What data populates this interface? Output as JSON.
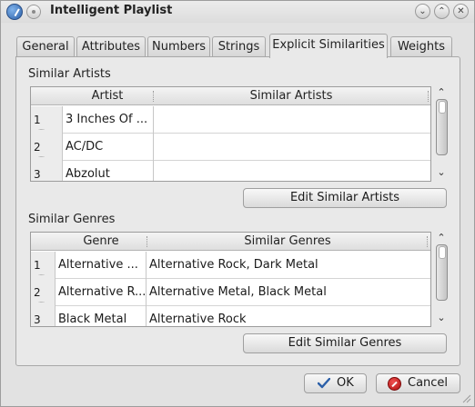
{
  "window": {
    "title": "Intelligent Playlist"
  },
  "tabs": [
    {
      "label": "General"
    },
    {
      "label": "Attributes"
    },
    {
      "label": "Numbers"
    },
    {
      "label": "Strings"
    },
    {
      "label": "Explicit Similarities",
      "active": true
    },
    {
      "label": "Weights"
    }
  ],
  "artists": {
    "group_label": "Similar Artists",
    "columns": [
      "Artist",
      "Similar Artists"
    ],
    "rows": [
      {
        "num": "1",
        "artist": "3 Inches Of ...",
        "similar": ""
      },
      {
        "num": "2",
        "artist": "AC/DC",
        "similar": ""
      },
      {
        "num": "3",
        "artist": "Abzolut",
        "similar": ""
      }
    ],
    "edit_button": "Edit Similar Artists"
  },
  "genres": {
    "group_label": "Similar Genres",
    "columns": [
      "Genre",
      "Similar Genres"
    ],
    "rows": [
      {
        "num": "1",
        "genre": "Alternative ...",
        "similar": "Alternative Rock, Dark Metal"
      },
      {
        "num": "2",
        "genre": "Alternative R...",
        "similar": "Alternative Metal, Black Metal"
      },
      {
        "num": "3",
        "genre": "Black Metal",
        "similar": "Alternative Rock"
      }
    ],
    "edit_button": "Edit Similar Genres"
  },
  "footer": {
    "ok_label": "OK",
    "cancel_label": "Cancel"
  },
  "colors": {
    "ok_check": "#2b5fa8",
    "cancel_red": "#c41a1a"
  },
  "icons": [
    "app-icon",
    "menu-icon",
    "minimize-icon",
    "maximize-icon",
    "close-icon",
    "scroll-up-icon",
    "scroll-down-icon",
    "ok-check-icon",
    "cancel-icon",
    "resize-grip-icon"
  ]
}
